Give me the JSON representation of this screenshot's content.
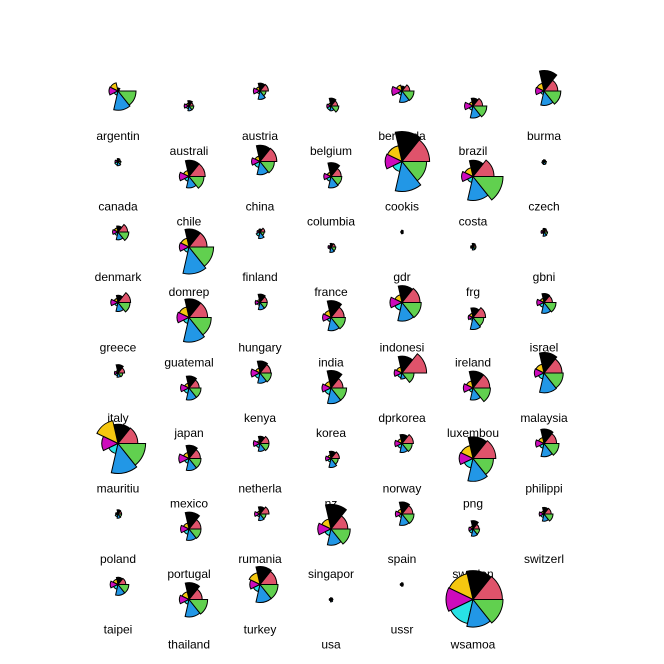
{
  "chart_data": {
    "type": "segment-star",
    "segment_colors": [
      "#DF536B",
      "#000000",
      "#F5C710",
      "#CD0BBC",
      "#28E2E5",
      "#2297E6",
      "#61D04F"
    ],
    "stars": [
      {
        "label": "argentin",
        "values": [
          0.05,
          0.1,
          0.28,
          0.3,
          0.14,
          0.64,
          0.6
        ]
      },
      {
        "label": "australi",
        "values": [
          0.14,
          0.18,
          0.1,
          0.16,
          0.1,
          0.16,
          0.16
        ]
      },
      {
        "label": "austria",
        "values": [
          0.28,
          0.26,
          0.14,
          0.22,
          0.1,
          0.28,
          0.2
        ]
      },
      {
        "label": "belgium",
        "values": [
          0.22,
          0.26,
          0.1,
          0.14,
          0.14,
          0.16,
          0.26
        ]
      },
      {
        "label": "bermuda",
        "values": [
          0.26,
          0.16,
          0.2,
          0.34,
          0.14,
          0.38,
          0.4
        ]
      },
      {
        "label": "brazil",
        "values": [
          0.32,
          0.26,
          0.14,
          0.28,
          0.14,
          0.4,
          0.46
        ]
      },
      {
        "label": "burma",
        "values": [
          0.46,
          0.68,
          0.26,
          0.28,
          0.12,
          0.48,
          0.56
        ]
      },
      {
        "label": "canada",
        "values": [
          0.08,
          0.1,
          0.06,
          0.1,
          0.12,
          0.14,
          0.1
        ]
      },
      {
        "label": "chile",
        "values": [
          0.54,
          0.54,
          0.2,
          0.32,
          0.16,
          0.38,
          0.5
        ]
      },
      {
        "label": "china",
        "values": [
          0.56,
          0.54,
          0.18,
          0.28,
          0.2,
          0.44,
          0.48
        ]
      },
      {
        "label": "columbia",
        "values": [
          0.34,
          0.46,
          0.14,
          0.24,
          0.16,
          0.38,
          0.36
        ]
      },
      {
        "label": "cookis",
        "values": [
          0.92,
          1.0,
          0.54,
          0.56,
          0.34,
          1.0,
          0.82
        ]
      },
      {
        "label": "costa",
        "values": [
          0.7,
          0.54,
          0.3,
          0.38,
          0.2,
          0.8,
          1.0
        ]
      },
      {
        "label": "czech",
        "values": [
          0.06,
          0.06,
          0.04,
          0.06,
          0.08,
          0.1,
          0.08
        ]
      },
      {
        "label": "denmark",
        "values": [
          0.32,
          0.2,
          0.14,
          0.18,
          0.12,
          0.26,
          0.36
        ]
      },
      {
        "label": "domrep",
        "values": [
          0.6,
          0.6,
          0.3,
          0.32,
          0.18,
          0.9,
          0.82
        ]
      },
      {
        "label": "finland",
        "values": [
          0.16,
          0.1,
          0.08,
          0.1,
          0.14,
          0.22,
          0.14
        ]
      },
      {
        "label": "france",
        "values": [
          0.14,
          0.12,
          0.06,
          0.1,
          0.08,
          0.18,
          0.16
        ]
      },
      {
        "label": "gdr",
        "values": [
          0.04,
          0.06,
          0.04,
          0.04,
          0.04,
          0.06,
          0.04
        ]
      },
      {
        "label": "frg",
        "values": [
          0.1,
          0.12,
          0.06,
          0.08,
          0.06,
          0.1,
          0.1
        ]
      },
      {
        "label": "gbni",
        "values": [
          0.1,
          0.12,
          0.08,
          0.1,
          0.06,
          0.14,
          0.12
        ]
      },
      {
        "label": "greece",
        "values": [
          0.42,
          0.24,
          0.14,
          0.24,
          0.12,
          0.3,
          0.4
        ]
      },
      {
        "label": "guatemal",
        "values": [
          0.62,
          0.62,
          0.36,
          0.4,
          0.2,
          0.82,
          0.74
        ]
      },
      {
        "label": "hungary",
        "values": [
          0.24,
          0.28,
          0.1,
          0.16,
          0.1,
          0.24,
          0.24
        ]
      },
      {
        "label": "india",
        "values": [
          0.44,
          0.56,
          0.24,
          0.28,
          0.14,
          0.44,
          0.48
        ]
      },
      {
        "label": "indonesi",
        "values": [
          0.6,
          0.56,
          0.26,
          0.4,
          0.26,
          0.62,
          0.64
        ]
      },
      {
        "label": "ireland",
        "values": [
          0.42,
          0.32,
          0.14,
          0.16,
          0.1,
          0.4,
          0.36
        ]
      },
      {
        "label": "israel",
        "values": [
          0.28,
          0.3,
          0.14,
          0.24,
          0.16,
          0.36,
          0.4
        ]
      },
      {
        "label": "italy",
        "values": [
          0.22,
          0.28,
          0.08,
          0.12,
          0.1,
          0.14,
          0.16
        ]
      },
      {
        "label": "japan",
        "values": [
          0.34,
          0.4,
          0.16,
          0.28,
          0.18,
          0.4,
          0.4
        ]
      },
      {
        "label": "kenya",
        "values": [
          0.36,
          0.4,
          0.16,
          0.3,
          0.18,
          0.34,
          0.38
        ]
      },
      {
        "label": "korea",
        "values": [
          0.4,
          0.58,
          0.22,
          0.3,
          0.22,
          0.52,
          0.52
        ]
      },
      {
        "label": "dprkorea",
        "values": [
          0.82,
          0.56,
          0.2,
          0.26,
          0.16,
          0.2,
          0.4
        ]
      },
      {
        "label": "luxembou",
        "values": [
          0.56,
          0.56,
          0.24,
          0.32,
          0.14,
          0.4,
          0.58
        ]
      },
      {
        "label": "malaysia",
        "values": [
          0.6,
          0.68,
          0.3,
          0.32,
          0.2,
          0.66,
          0.64
        ]
      },
      {
        "label": "mauritiu",
        "values": [
          0.66,
          0.64,
          0.78,
          0.54,
          0.34,
          1.0,
          0.92
        ]
      },
      {
        "label": "mexico",
        "values": [
          0.38,
          0.44,
          0.2,
          0.34,
          0.16,
          0.4,
          0.4
        ]
      },
      {
        "label": "netherla",
        "values": [
          0.3,
          0.24,
          0.1,
          0.22,
          0.14,
          0.26,
          0.3
        ]
      },
      {
        "label": "nz",
        "values": [
          0.28,
          0.24,
          0.12,
          0.18,
          0.12,
          0.3,
          0.24
        ]
      },
      {
        "label": "norway",
        "values": [
          0.38,
          0.3,
          0.16,
          0.24,
          0.16,
          0.3,
          0.34
        ]
      },
      {
        "label": "png",
        "values": [
          0.76,
          0.72,
          0.44,
          0.46,
          0.32,
          0.76,
          0.68
        ]
      },
      {
        "label": "philippi",
        "values": [
          0.42,
          0.48,
          0.2,
          0.28,
          0.16,
          0.44,
          0.5
        ]
      },
      {
        "label": "poland",
        "values": [
          0.12,
          0.14,
          0.06,
          0.08,
          0.1,
          0.14,
          0.12
        ]
      },
      {
        "label": "portugal",
        "values": [
          0.4,
          0.56,
          0.2,
          0.28,
          0.18,
          0.38,
          0.4
        ]
      },
      {
        "label": "rumania",
        "values": [
          0.3,
          0.24,
          0.1,
          0.18,
          0.1,
          0.22,
          0.2
        ]
      },
      {
        "label": "singapor",
        "values": [
          0.56,
          0.82,
          0.34,
          0.44,
          0.22,
          0.54,
          0.64
        ]
      },
      {
        "label": "spain",
        "values": [
          0.36,
          0.4,
          0.16,
          0.22,
          0.12,
          0.38,
          0.4
        ]
      },
      {
        "label": "sweden",
        "values": [
          0.2,
          0.28,
          0.1,
          0.14,
          0.14,
          0.24,
          0.22
        ]
      },
      {
        "label": "switzerl",
        "values": [
          0.24,
          0.22,
          0.1,
          0.16,
          0.12,
          0.24,
          0.3
        ]
      },
      {
        "label": "taipei",
        "values": [
          0.26,
          0.24,
          0.18,
          0.26,
          0.16,
          0.36,
          0.36
        ]
      },
      {
        "label": "thailand",
        "values": [
          0.44,
          0.56,
          0.26,
          0.32,
          0.16,
          0.58,
          0.62
        ]
      },
      {
        "label": "turkey",
        "values": [
          0.56,
          0.6,
          0.4,
          0.34,
          0.24,
          0.6,
          0.6
        ]
      },
      {
        "label": "usa",
        "values": [
          0.06,
          0.06,
          0.04,
          0.06,
          0.04,
          0.08,
          0.06
        ]
      },
      {
        "label": "ussr",
        "values": [
          0.04,
          0.06,
          0.04,
          0.06,
          0.04,
          0.06,
          0.04
        ]
      },
      {
        "label": "wsamoa",
        "values": [
          0.98,
          0.96,
          0.88,
          0.9,
          0.82,
          0.92,
          1.0
        ]
      }
    ]
  }
}
